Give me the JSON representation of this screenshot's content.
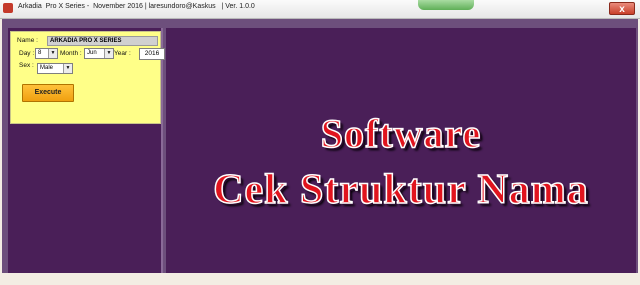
{
  "window": {
    "title": "Arkadia  Pro X Series -  November 2016 | laresundoro@Kaskus   | Ver. 1.0.0",
    "close_symbol": "x"
  },
  "form": {
    "name_label": "Name :",
    "name_value": "ARKADIA PRO X SERIES",
    "day_label": "Day :",
    "day_value": "8",
    "month_label": "Month :",
    "month_value": "Jun",
    "year_label": "Year :",
    "year_value": "2016",
    "sex_label": "Sex :",
    "sex_value": "Male",
    "execute_label": "Execute"
  },
  "banner": {
    "line1": "Software",
    "line2": "Cek Struktur Nama"
  },
  "colors": {
    "panel_purple": "#4a1f58",
    "form_yellow": "#ffff88",
    "button_orange": "#f0a010",
    "banner_red": "#e0141e"
  },
  "icons": {
    "app": "app-icon",
    "close": "close-icon",
    "dropdown": "chevron-down-icon"
  }
}
